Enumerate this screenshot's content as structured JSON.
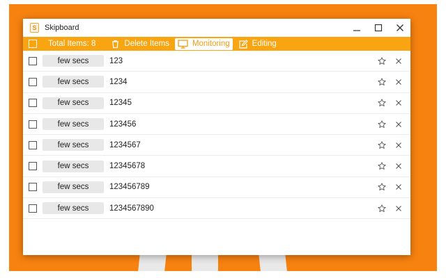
{
  "window": {
    "app_icon_letter": "S",
    "title": "Skipboard"
  },
  "toolbar": {
    "total_label": "Total Items: 8",
    "delete_label": "Delete Items",
    "monitoring_label": "Monitoring",
    "editing_label": "Editing",
    "active_mode": "Monitoring"
  },
  "items": [
    {
      "time": "few secs",
      "text": "123"
    },
    {
      "time": "few secs",
      "text": "1234"
    },
    {
      "time": "few secs",
      "text": "12345"
    },
    {
      "time": "few secs",
      "text": "123456"
    },
    {
      "time": "few secs",
      "text": "1234567"
    },
    {
      "time": "few secs",
      "text": "12345678"
    },
    {
      "time": "few secs",
      "text": "123456789"
    },
    {
      "time": "few secs",
      "text": "1234567890"
    }
  ],
  "colors": {
    "backdrop": "#f7820f",
    "toolbar": "#f9a512",
    "accent": "#f39c12"
  }
}
